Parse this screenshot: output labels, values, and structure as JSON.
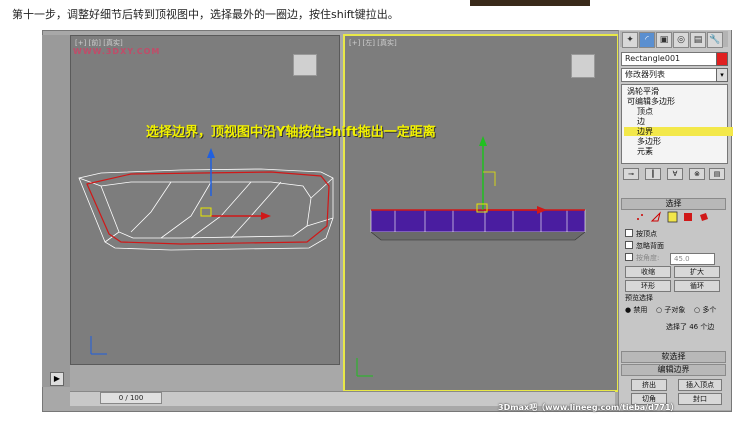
{
  "caption": "第十一步，调整好细节后转到顶视图中，选择最外的一圈边，按住shift键拉出。",
  "viewports": {
    "left_label": "[+] [前] [真实]",
    "left_watermark": "WWW.3DXY.COM",
    "right_label": "[+] [左] [真实]",
    "overlay_text": "选择边界，顶视图中沿Y轴按住shift拖出一定距离"
  },
  "timeline": {
    "frame": "0 / 100"
  },
  "command_panel": {
    "tabs": [
      "✦",
      "◜",
      "▣",
      "◎",
      "▤",
      "🔧"
    ],
    "object_name": "Rectangle001",
    "modifier_list": "修改器列表",
    "stack": [
      {
        "label": "涡轮平滑",
        "selected": false
      },
      {
        "label": "可编辑多边形",
        "selected": false
      },
      {
        "label": "顶点",
        "selected": false
      },
      {
        "label": "边",
        "selected": false
      },
      {
        "label": "边界",
        "selected": true
      },
      {
        "label": "多边形",
        "selected": false
      },
      {
        "label": "元素",
        "selected": false
      }
    ],
    "selection_rollout": {
      "title": "选择",
      "by_vertex": "按顶点",
      "ignore_backfacing": "忽略背面",
      "by_angle": "按角度:",
      "angle_value": "45.0",
      "shrink": "收缩",
      "grow": "扩大",
      "ring": "环形",
      "loop": "循环",
      "preview_title": "预览选择",
      "preview_disabled": "禁用",
      "preview_subobj": "子对象",
      "preview_multi": "多个",
      "status": "选择了 46 个边"
    },
    "soft_selection": "软选择",
    "edit_borders": "编辑边界",
    "extrude": "挤出",
    "insert_vertex": "插入顶点",
    "chamfer": "切角",
    "cap": "封口"
  },
  "footer_watermark": "3Dmax吧（www.lineeg.com/tieba/d771）"
}
